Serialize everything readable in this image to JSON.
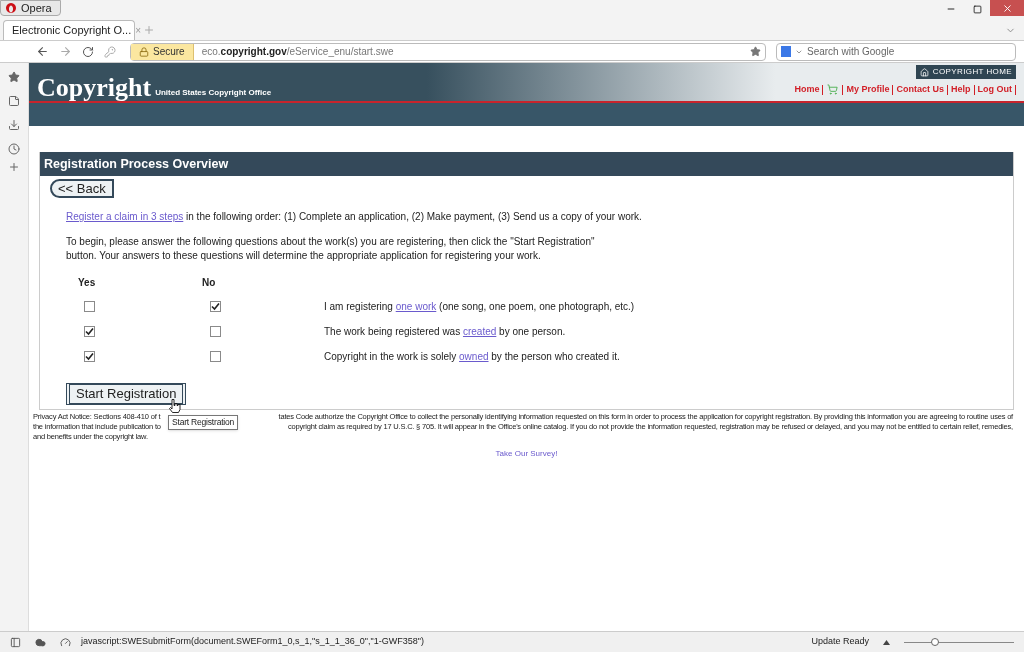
{
  "browser": {
    "app_button": "Opera",
    "tab": {
      "title": "Electronic Copyright O...",
      "close": "×"
    },
    "address": {
      "secure": "Secure",
      "prefix": "eco.",
      "domain": "copyright.gov",
      "path": "/eService_enu/start.swe"
    },
    "search": {
      "placeholder": "Search with Google"
    }
  },
  "site": {
    "logo": "Copyright",
    "subtitle": "United States Copyright Office",
    "home_button": "COPYRIGHT HOME",
    "nav": [
      {
        "kind": "link",
        "label": "Home"
      },
      {
        "kind": "cart"
      },
      {
        "kind": "link",
        "label": "My Profile"
      },
      {
        "kind": "link",
        "label": "Contact Us"
      },
      {
        "kind": "link",
        "label": "Help"
      },
      {
        "kind": "link",
        "label": "Log Out"
      }
    ]
  },
  "panel": {
    "title": "Registration Process Overview",
    "back_button": "<< Back",
    "intro": {
      "link": "Register a claim in 3 steps",
      "text": " in the following order: (1) Complete an application, (2) Make payment, (3) Send us a copy of your work."
    },
    "instructions": "To begin, please answer the following questions about the work(s) you are registering, then click the \"Start Registration\" button. Your answers to these questions will determine the appropriate application for registering your work.",
    "columns": [
      "Yes",
      "No"
    ],
    "questions": [
      {
        "yes": false,
        "no": true,
        "before": "I am registering ",
        "link": "one work",
        "after": " (one song, one poem, one photograph, etc.)"
      },
      {
        "yes": true,
        "no": false,
        "before": "The work being registered was ",
        "link": "created",
        "after": " by one person."
      },
      {
        "yes": true,
        "no": false,
        "before": "Copyright in the work is solely ",
        "link": "owned",
        "after": " by the person who created it."
      }
    ],
    "start_button": "Start Registration",
    "tooltip": "Start Registration"
  },
  "privacy": [
    {
      "left": "Privacy Act Notice: Sections 408-410 of t",
      "right": "tates Code authorize the Copyright Office to collect the personally identifying information requested on this form in order to process the application for copyright registration. By providing this information you are agreeing to routine uses of"
    },
    {
      "left": "the information that include publication to",
      "right": "copyright claim as required by 17 U.S.C. § 705. It will appear in the Office's online catalog. If you do not provide the information requested, registration may be refused or delayed, and you may not be entitled to certain relief, remedies,"
    },
    {
      "left": "and benefits under the copyright law."
    }
  ],
  "survey_link": "Take Our Survey!",
  "status_bar": {
    "url": "javascript:SWESubmitForm(document.SWEForm1_0,s_1,\"s_1_1_36_0\",\"1-GWF358\")",
    "update": "Update Ready",
    "zoom": {
      "level": 0.28
    }
  }
}
